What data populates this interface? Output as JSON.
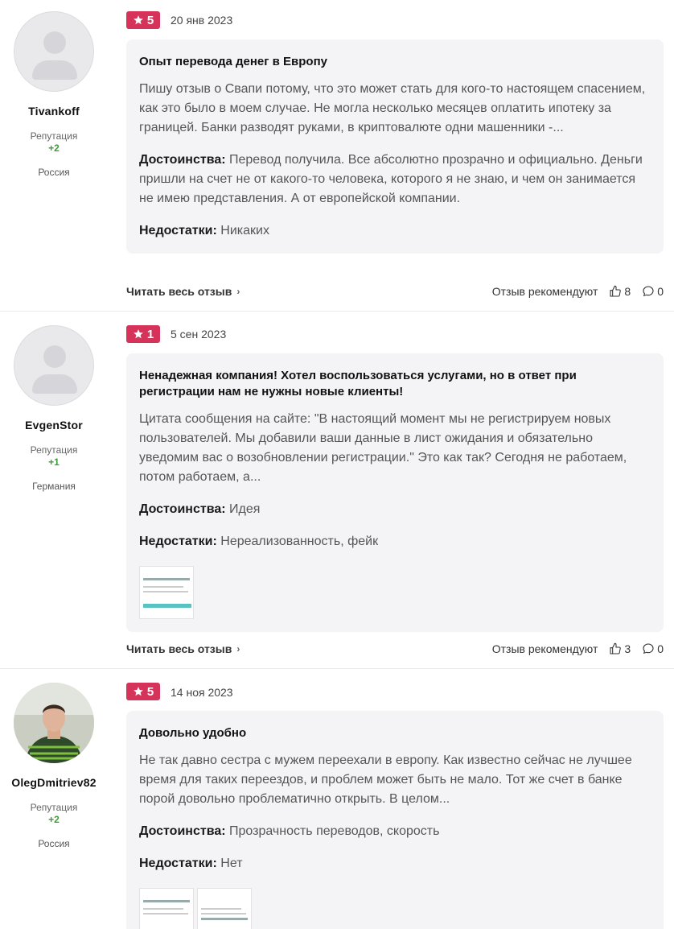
{
  "reviews": [
    {
      "rating": "5",
      "date": "20 янв 2023",
      "username": "Tivankoff",
      "reputation_label": "Репутация",
      "reputation_value": "+2",
      "country": "Россия",
      "title": "Опыт перевода денег в Европу",
      "text": "Пишу отзыв о Свапи потому, что это может стать для кого-то настоящем спасением, как это было в моем случае. Не могла несколько месяцев оплатить ипотеку за границей. Банки разводят руками, в криптовалюте одни машенники -...",
      "pros_label": "Достоинства:",
      "pros": "Перевод получила. Все абсолютно прозрачно и официально. Деньги пришли на счет не от какого-то человека, которого я не знаю, и чем он занимается не имею представления. А от европейской компании.",
      "cons_label": "Недостатки:",
      "cons": "Никаких",
      "read_more": "Читать весь отзыв",
      "recommend_label": "Отзыв рекомендуют",
      "likes": "8",
      "comments": "0"
    },
    {
      "rating": "1",
      "date": "5 сен 2023",
      "username": "EvgenStor",
      "reputation_label": "Репутация",
      "reputation_value": "+1",
      "country": "Германия",
      "title": "Ненадежная компания! Хотел воспользоваться услугами, но в ответ при регистрации нам не нужны новые клиенты!",
      "text": "Цитата сообщения на сайте: \"В настоящий момент мы не регистрируем новых пользователей. Мы добавили ваши данные в лист ожидания и обязательно уведомим вас о возобновлении регистрации.\" Это как так? Сегодня не работаем, потом работаем, а...",
      "pros_label": "Достоинства:",
      "pros": "Идея",
      "cons_label": "Недостатки:",
      "cons": "Нереализованность, фейк",
      "read_more": "Читать весь отзыв",
      "recommend_label": "Отзыв рекомендуют",
      "likes": "3",
      "comments": "0"
    },
    {
      "rating": "5",
      "date": "14 ноя 2023",
      "username": "OlegDmitriev82",
      "reputation_label": "Репутация",
      "reputation_value": "+2",
      "country": "Россия",
      "title": "Довольно удобно",
      "text": "Не так давно сестра с мужем переехали в европу. Как известно сейчас не лучшее время для таких переездов, и проблем может быть не мало. Тот же счет в банке порой довольно проблематично открыть. В целом...",
      "pros_label": "Достоинства:",
      "pros": "Прозрачность переводов, скорость",
      "cons_label": "Недостатки:",
      "cons": "Нет"
    }
  ],
  "colors": {
    "rating_badge": "#d6335a",
    "reputation": "#3f9a3a",
    "card_bg": "#f4f4f6"
  }
}
